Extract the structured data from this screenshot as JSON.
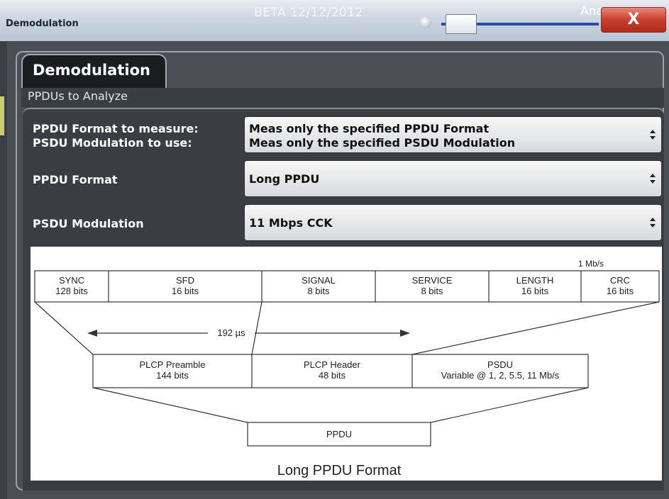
{
  "window": {
    "title": "Demodulation",
    "beta": "BETA 12/12/2012",
    "ana": "Ana",
    "close": "X"
  },
  "tab": {
    "label": "Demodulation"
  },
  "section": {
    "label": "PPDUs to Analyze"
  },
  "settings": {
    "format_to_measure_label": "PPDU Format to measure:",
    "modulation_to_use_label": "PSDU Modulation to use:",
    "format_to_measure_value": "Meas only the specified PPDU Format",
    "modulation_to_use_value": "Meas only the specified PSDU Modulation",
    "ppdu_format_label": "PPDU Format",
    "ppdu_format_value": "Long PPDU",
    "psdu_modulation_label": "PSDU Modulation",
    "psdu_modulation_value": "11 Mbps CCK"
  },
  "diagram": {
    "rate": "1 Mb/s",
    "fields": [
      {
        "name": "SYNC",
        "bits": "128 bits"
      },
      {
        "name": "SFD",
        "bits": "16 bits"
      },
      {
        "name": "SIGNAL",
        "bits": "8 bits"
      },
      {
        "name": "SERVICE",
        "bits": "8 bits"
      },
      {
        "name": "LENGTH",
        "bits": "16 bits"
      },
      {
        "name": "CRC",
        "bits": "16 bits"
      }
    ],
    "duration": "192 µs",
    "blocks": [
      {
        "name": "PLCP Preamble",
        "detail": "144 bits"
      },
      {
        "name": "PLCP Header",
        "detail": "48 bits"
      },
      {
        "name": "PSDU",
        "detail": "Variable @ 1, 2, 5.5, 11 Mb/s"
      }
    ],
    "ppdu": "PPDU",
    "caption": "Long PPDU Format"
  },
  "colors": {
    "accent_blue": "#2b4aa8",
    "close_red": "#c8402f",
    "panel_dark": "#3a3d42"
  }
}
